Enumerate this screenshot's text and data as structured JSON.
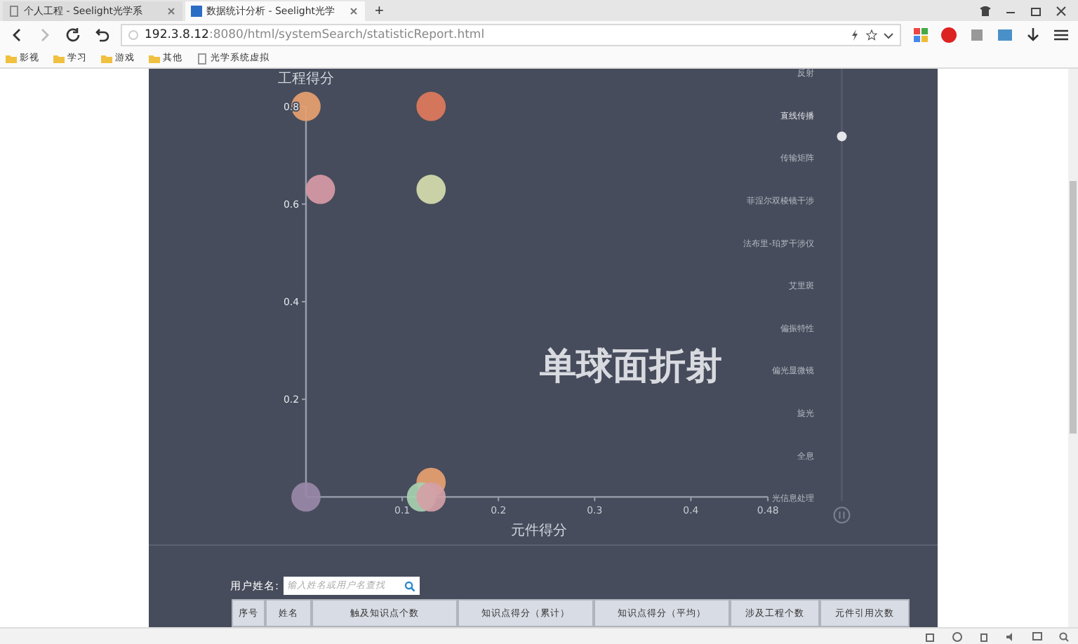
{
  "browser": {
    "tabs": [
      {
        "label": "个人工程 - Seelight光学系",
        "selected": false
      },
      {
        "label": "数据统计分析 - Seelight光学",
        "selected": true
      }
    ],
    "new_tab": "+",
    "address": {
      "host": "192.3.8.12",
      "path": ":8080/html/systemSearch/statisticReport.html"
    },
    "bookmarks": [
      {
        "label": "影视",
        "kind": "folder"
      },
      {
        "label": "学习",
        "kind": "folder"
      },
      {
        "label": "游戏",
        "kind": "folder"
      },
      {
        "label": "其他",
        "kind": "folder"
      },
      {
        "label": "光学系统虚拟",
        "kind": "page"
      }
    ]
  },
  "report": {
    "chart_data": {
      "type": "scatter",
      "title": "单球面折射",
      "xlabel": "元件得分",
      "ylabel": "工程得分",
      "xlim": [
        0,
        0.48
      ],
      "ylim": [
        0,
        0.8
      ],
      "xticks": [
        0.1,
        0.2,
        0.3,
        0.4,
        0.48
      ],
      "yticks": [
        0.2,
        0.4,
        0.6,
        0.8
      ],
      "series": [
        {
          "color": "#e8a070",
          "x": [
            0
          ],
          "values": [
            0.8
          ]
        },
        {
          "color": "#e07a5c",
          "x": [
            0.13
          ],
          "values": [
            0.8
          ]
        },
        {
          "color": "#d89aa6",
          "x": [
            0.015
          ],
          "values": [
            0.63
          ]
        },
        {
          "color": "#d6dcae",
          "x": [
            0.13
          ],
          "values": [
            0.63
          ]
        },
        {
          "color": "#9a88a8",
          "x": [
            0
          ],
          "values": [
            0
          ]
        },
        {
          "color": "#e8a070",
          "x": [
            0.13
          ],
          "values": [
            0.03
          ]
        },
        {
          "color": "#a8d0b0",
          "x": [
            0.12
          ],
          "values": [
            0
          ]
        },
        {
          "color": "#d4a0a6",
          "x": [
            0.13
          ],
          "values": [
            0
          ]
        }
      ]
    },
    "timeline": [
      {
        "label": "反射",
        "selected": false
      },
      {
        "label": "直线传播",
        "selected": true
      },
      {
        "label": "传输矩阵",
        "selected": false
      },
      {
        "label": "菲涅尔双棱镜干涉",
        "selected": false
      },
      {
        "label": "法布里-珀罗干涉仪",
        "selected": false
      },
      {
        "label": "艾里斑",
        "selected": false
      },
      {
        "label": "偏振特性",
        "selected": false
      },
      {
        "label": "偏光显微镜",
        "selected": false
      },
      {
        "label": "旋光",
        "selected": false
      },
      {
        "label": "全息",
        "selected": false
      },
      {
        "label": "光信息处理",
        "selected": false
      }
    ],
    "search": {
      "label": "用户姓名:",
      "placeholder": "输入姓名或用户名查找"
    },
    "table": {
      "columns": [
        "序号",
        "姓名",
        "触及知识点个数",
        "知识点得分（累计）",
        "知识点得分（平均）",
        "涉及工程个数",
        "元件引用次数"
      ]
    }
  }
}
